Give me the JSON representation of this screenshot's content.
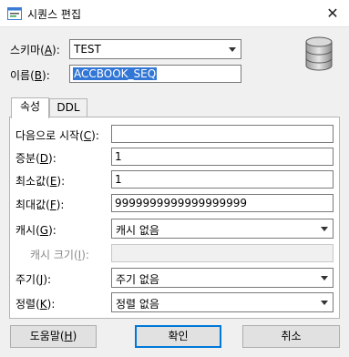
{
  "window": {
    "title": "시퀀스 편집",
    "close_glyph": "✕"
  },
  "schema": {
    "label": "스키마",
    "mnemonic": "A",
    "value": "TEST"
  },
  "name": {
    "label": "이름",
    "mnemonic": "B",
    "value": "ACCBOOK_SEQ"
  },
  "tabs": [
    {
      "label": "속성"
    },
    {
      "label": "DDL"
    }
  ],
  "properties": {
    "start_with": {
      "label": "다음으로 시작",
      "mnemonic": "C",
      "value": ""
    },
    "increment": {
      "label": "증분",
      "mnemonic": "D",
      "value": "1"
    },
    "min_value": {
      "label": "최소값",
      "mnemonic": "E",
      "value": "1"
    },
    "max_value": {
      "label": "최대값",
      "mnemonic": "F",
      "value": "9999999999999999999"
    },
    "cache": {
      "label": "캐시",
      "mnemonic": "G",
      "value": "캐시 없음"
    },
    "cache_size": {
      "label": "캐시 크기",
      "mnemonic": "I",
      "value": ""
    },
    "cycle": {
      "label": "주기",
      "mnemonic": "J",
      "value": "주기 없음"
    },
    "order": {
      "label": "정렬",
      "mnemonic": "K",
      "value": "정렬 없음"
    }
  },
  "buttons": {
    "help": {
      "label": "도움말",
      "mnemonic": "H"
    },
    "ok": {
      "label": "확인"
    },
    "cancel": {
      "label": "취소"
    }
  },
  "icons": {
    "title": "sequence-edit-icon",
    "database": "database-icon"
  }
}
